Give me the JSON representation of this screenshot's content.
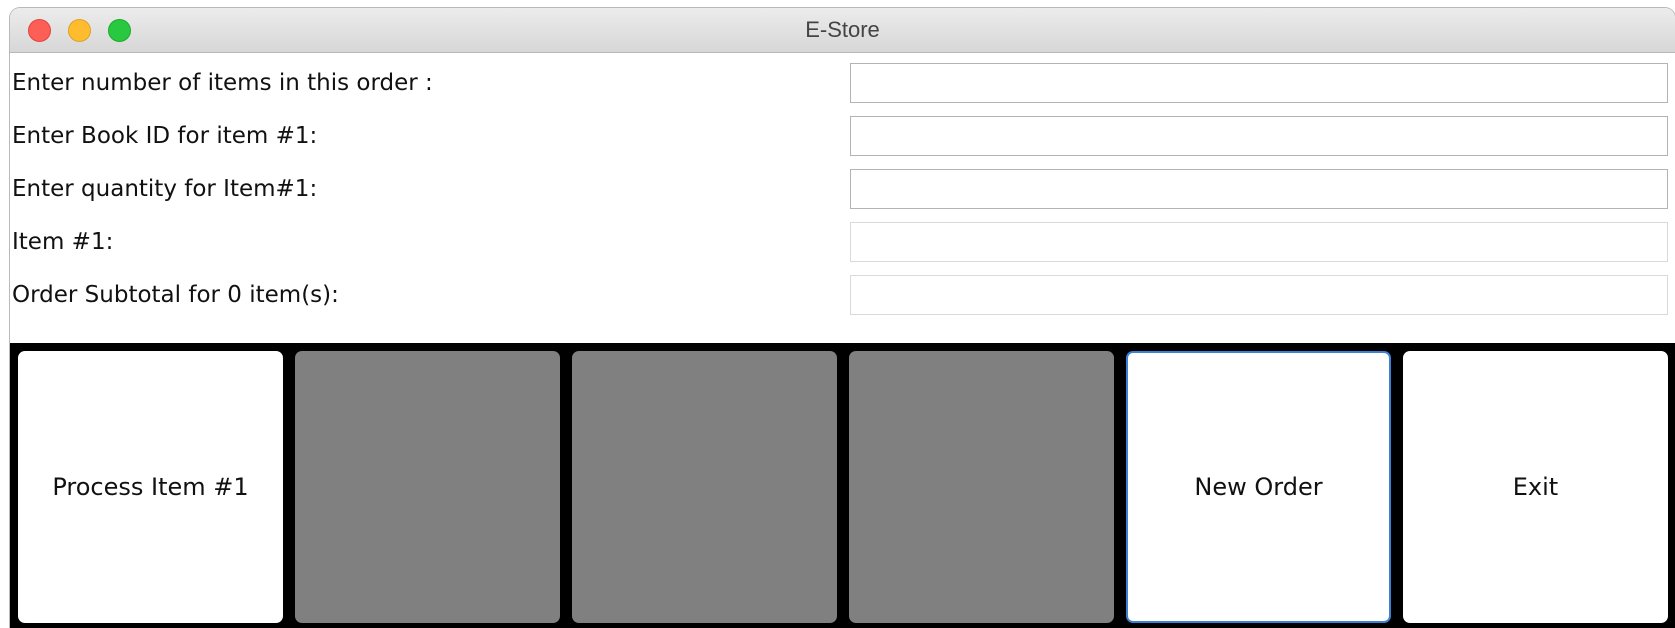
{
  "window": {
    "title": "E-Store"
  },
  "form": {
    "rows": [
      {
        "label": "Enter number of items in this order :",
        "value": ""
      },
      {
        "label": "Enter Book ID for item #1:",
        "value": ""
      },
      {
        "label": "Enter quantity for Item#1:",
        "value": ""
      },
      {
        "label": "Item #1:",
        "value": ""
      },
      {
        "label": "Order Subtotal for 0 item(s):",
        "value": ""
      }
    ]
  },
  "buttons": {
    "process_label": "Process Item #1",
    "new_order_label": "New Order",
    "exit_label": "Exit"
  },
  "colors": {
    "close": "#fd5f57",
    "minimize": "#febc2e",
    "zoom": "#28c840",
    "disabled_button": "#808080",
    "focus_ring": "#3b82d6"
  }
}
